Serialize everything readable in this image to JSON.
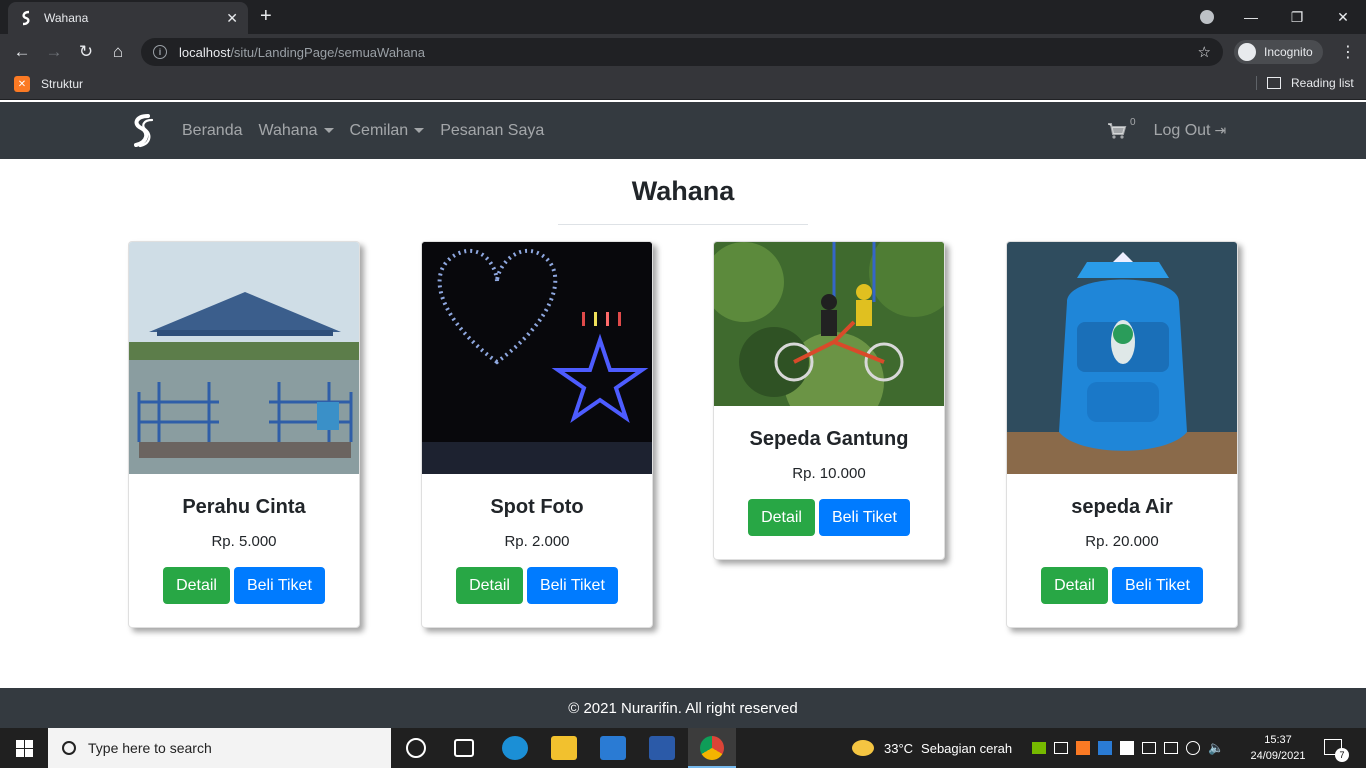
{
  "browser": {
    "tab_title": "Wahana",
    "tab_close": "✕",
    "new_tab": "+",
    "url_host": "localhost",
    "url_path": "/situ/LandingPage/semuaWahana",
    "incognito_label": "Incognito",
    "bookmark": "Struktur",
    "reading_list": "Reading list"
  },
  "nav": {
    "items": [
      {
        "label": "Beranda"
      },
      {
        "label": "Wahana"
      },
      {
        "label": "Cemilan"
      },
      {
        "label": "Pesanan Saya"
      }
    ],
    "cart_count": "0",
    "logout": "Log Out"
  },
  "page": {
    "title": "Wahana"
  },
  "cards": [
    {
      "name": "Perahu Cinta",
      "price": "Rp. 5.000",
      "detail": "Detail",
      "buy": "Beli Tiket"
    },
    {
      "name": "Spot Foto",
      "price": "Rp. 2.000",
      "detail": "Detail",
      "buy": "Beli Tiket"
    },
    {
      "name": "Sepeda Gantung",
      "price": "Rp. 10.000",
      "detail": "Detail",
      "buy": "Beli Tiket"
    },
    {
      "name": "sepeda Air",
      "price": "Rp. 20.000",
      "detail": "Detail",
      "buy": "Beli Tiket"
    }
  ],
  "footer": {
    "text": "© 2021 Nurarifin. All right reserved"
  },
  "taskbar": {
    "search_placeholder": "Type here to search",
    "weather_temp": "33°C",
    "weather_desc": "Sebagian cerah",
    "time": "15:37",
    "date": "24/09/2021",
    "notification_count": "7"
  },
  "colors": {
    "navbar": "#343a40",
    "success": "#28a745",
    "primary": "#007bff"
  }
}
